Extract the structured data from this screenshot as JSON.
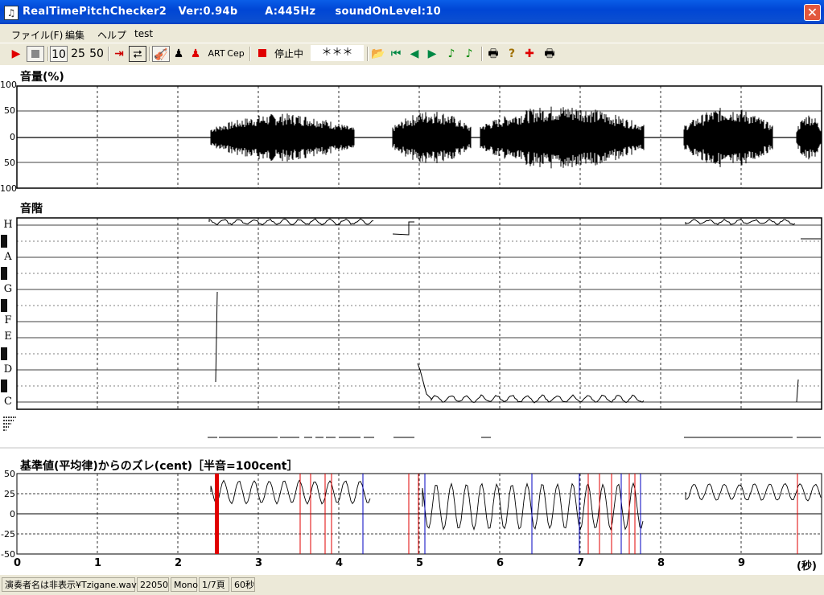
{
  "window": {
    "title": "RealTimePitchChecker2   Ver:0.94b       A:445Hz     soundOnLevel:10",
    "app_icon": "music-icon"
  },
  "menu": [
    "ファイル(F)",
    "編集",
    "ヘルプ",
    "test"
  ],
  "toolbar": {
    "span_buttons": [
      "10",
      "25",
      "50"
    ],
    "art_label": "ART",
    "cep_label": "Cep",
    "stop_state_label": "停止中",
    "display_value": "＊＊＊"
  },
  "volume_panel": {
    "title": "音量(%)",
    "y_ticks": [
      "100",
      "50",
      "0",
      "50",
      "100"
    ]
  },
  "scale_panel": {
    "title": "音階",
    "notes": [
      "H",
      "A",
      "G",
      "F",
      "E",
      "D",
      "C"
    ]
  },
  "cent_panel": {
    "title": "基準値(平均律)からのズレ(cent)［半音=100cent］",
    "y_ticks": [
      "50",
      "25",
      "0",
      "-25",
      "-50"
    ]
  },
  "time_axis": {
    "labels": [
      "0",
      "1",
      "2",
      "3",
      "4",
      "5",
      "6",
      "7",
      "8",
      "9"
    ],
    "unit": "(秒)"
  },
  "statusbar": {
    "file": "演奏者名は非表示¥Tzigane.wav",
    "rate": "22050",
    "channels": "Mono",
    "page": "1/7頁",
    "duration": "60秒"
  },
  "colors": {
    "titlebar": "#0046d5",
    "trace": "#000000",
    "red_mark": "#e00000",
    "blue_mark": "#0000c0"
  }
}
